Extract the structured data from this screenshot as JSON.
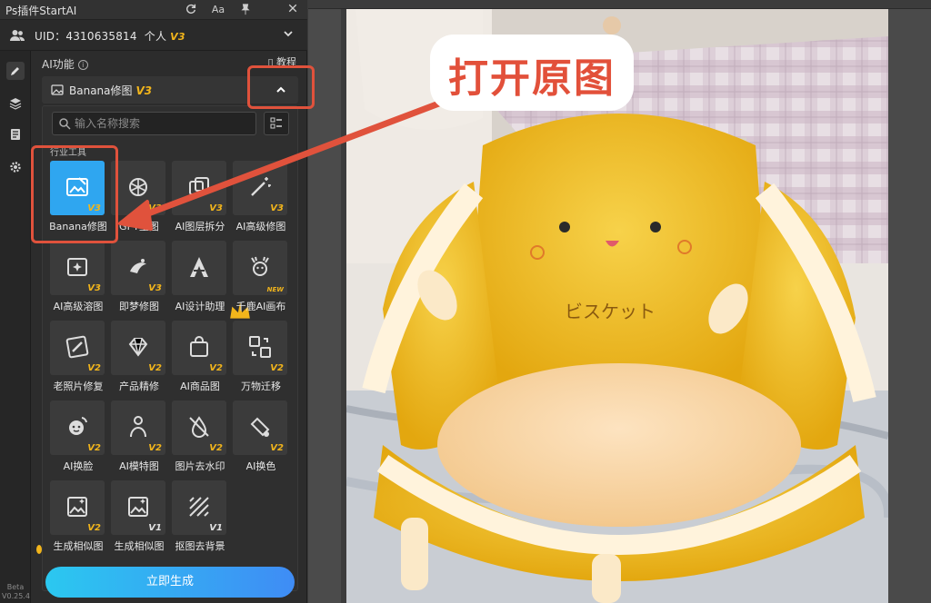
{
  "app": {
    "title": "Ps插件StartAI",
    "uid_text": "UID：4310635814",
    "account_type": "个人",
    "account_badge": "V3",
    "version_beta": "Beta",
    "version_number": "V0.25.4"
  },
  "toolbar_icons": [
    "refresh-icon",
    "font-size-icon",
    "pin-icon",
    "close-icon"
  ],
  "toolbar_font_label": "Aa",
  "section": {
    "title": "AI功能",
    "tutorial": "教程",
    "selected_tool": "Banana修图",
    "selected_badge": "V3"
  },
  "search": {
    "placeholder": "输入名称搜索"
  },
  "category_label": "行业工具",
  "tools": [
    {
      "label": "Banana修图",
      "badge": "V3",
      "icon": "image-edit-icon"
    },
    {
      "label": "GPT生图",
      "badge": "V3",
      "icon": "gpt-logo-icon"
    },
    {
      "label": "AI图层拆分",
      "badge": "V3",
      "icon": "layer-split-icon"
    },
    {
      "label": "AI高级修图",
      "badge": "V3",
      "icon": "magic-wand-icon"
    },
    {
      "label": "AI高级溶图",
      "badge": "V3",
      "icon": "sparkle-image-icon"
    },
    {
      "label": "即梦修图",
      "badge": "V3",
      "icon": "dream-icon"
    },
    {
      "label": "AI设计助理",
      "badge": "",
      "icon": "design-assistant-icon"
    },
    {
      "label": "千鹿AI画布",
      "badge": "NEW",
      "icon": "deer-icon"
    },
    {
      "label": "老照片修复",
      "badge": "V2",
      "icon": "photo-repair-icon"
    },
    {
      "label": "产品精修",
      "badge": "V2",
      "icon": "diamond-icon"
    },
    {
      "label": "AI商品图",
      "badge": "V2",
      "icon": "shopping-bag-icon"
    },
    {
      "label": "万物迁移",
      "badge": "V2",
      "icon": "transfer-icon"
    },
    {
      "label": "AI换脸",
      "badge": "V2",
      "icon": "face-swap-icon"
    },
    {
      "label": "AI模特图",
      "badge": "V2",
      "icon": "model-icon"
    },
    {
      "label": "图片去水印",
      "badge": "V2",
      "icon": "remove-watermark-icon"
    },
    {
      "label": "AI换色",
      "badge": "V2",
      "icon": "recolor-icon"
    },
    {
      "label": "生成相似图",
      "badge": "V2",
      "icon": "similar-image-icon"
    },
    {
      "label": "生成相似图",
      "badge": "V1",
      "icon": "similar-image-icon"
    },
    {
      "label": "抠图去背景",
      "badge": "V1",
      "icon": "cutout-icon"
    }
  ],
  "generate_button": "立即生成",
  "annotation": {
    "callout_text": "打开原图"
  },
  "photo": {
    "cushion_text": "ビスケット"
  },
  "colors": {
    "accent_gold": "#f2b51b",
    "selection_blue": "#2fa6f0",
    "annotation_red": "#e0523c",
    "button_gradient_start": "#2bc8f0",
    "button_gradient_end": "#3f8cf5"
  }
}
